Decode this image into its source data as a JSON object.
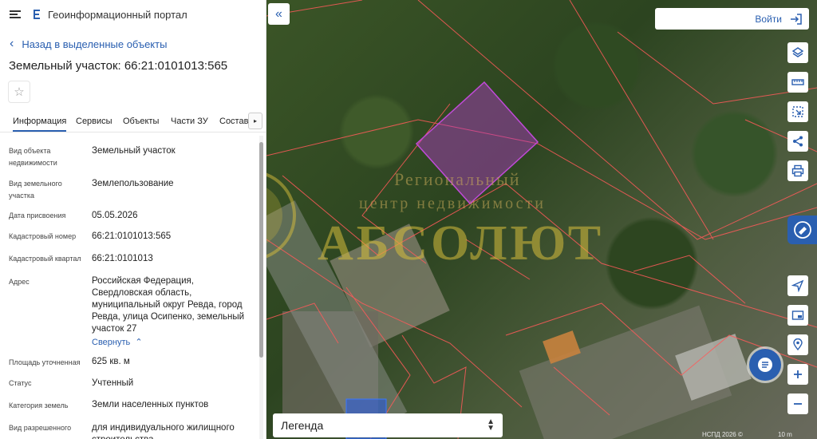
{
  "header": {
    "title": "Геоинформационный портал"
  },
  "nav": {
    "back_label": "Назад в выделенные объекты"
  },
  "plot": {
    "title": "Земельный участок: 66:21:0101013:565"
  },
  "tabs": [
    {
      "label": "Информация",
      "active": true
    },
    {
      "label": "Сервисы"
    },
    {
      "label": "Объекты"
    },
    {
      "label": "Части ЗУ"
    },
    {
      "label": "Состав"
    }
  ],
  "attributes": [
    {
      "label": "Вид объекта недвижимости",
      "value": "Земельный участок"
    },
    {
      "label": "Вид земельного участка",
      "value": "Землепользование"
    },
    {
      "label": "Дата присвоения",
      "value": "05.05.2026"
    },
    {
      "label": "Кадастровый номер",
      "value": "66:21:0101013:565"
    },
    {
      "label": "Кадастровый квартал",
      "value": "66:21:0101013"
    },
    {
      "label": "Адрес",
      "value": "Российская Федерация, Свердловская область, муниципальный округ Ревда, город Ревда, улица Осипенко, земельный участок 27"
    },
    {
      "label": "Площадь уточненная",
      "value": "625 кв. м"
    },
    {
      "label": "Статус",
      "value": "Учтенный"
    },
    {
      "label": "Категория земель",
      "value": "Земли населенных пунктов"
    },
    {
      "label": "Вид разрешенного",
      "value": "для индивидуального жилищного строительства"
    }
  ],
  "address_toggle": "Свернуть",
  "map": {
    "login_label": "Войти",
    "legend_label": "Легенда",
    "copyright": "НСПД 2026 ©",
    "scale": "10 m",
    "watermark": {
      "line1": "Региональный",
      "line2": "центр недвижимости",
      "line3": "АБСОЛЮТ"
    }
  },
  "colors": {
    "accent": "#2a5fb0",
    "parcel": "#b43cc8",
    "boundary": "#ff5a5a"
  }
}
